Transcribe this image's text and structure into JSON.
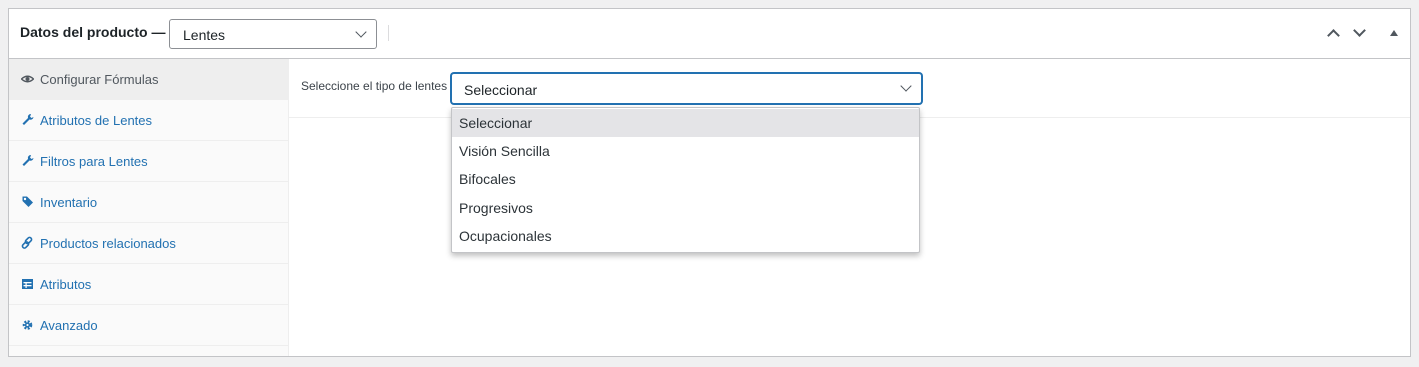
{
  "header": {
    "title": "Datos del producto —",
    "product_type": {
      "selected": "Lentes"
    }
  },
  "tabs": [
    {
      "label": "Configurar Fórmulas",
      "icon": "eye-icon",
      "active": true
    },
    {
      "label": "Atributos de Lentes",
      "icon": "wrench-icon"
    },
    {
      "label": "Filtros para Lentes",
      "icon": "wrench-icon"
    },
    {
      "label": "Inventario",
      "icon": "tag-icon"
    },
    {
      "label": "Productos relacionados",
      "icon": "link-icon"
    },
    {
      "label": "Atributos",
      "icon": "table-icon"
    },
    {
      "label": "Avanzado",
      "icon": "gear-icon"
    }
  ],
  "panel": {
    "lens_type_label": "Seleccione el tipo de lentes",
    "lens_type_value": "Seleccionar",
    "options": [
      "Seleccionar",
      "Visión Sencilla",
      "Bifocales",
      "Progresivos",
      "Ocupacionales"
    ]
  },
  "colors": {
    "link": "#2271b1",
    "border": "#c3c4c7",
    "active_tab_bg": "#eeeeee"
  }
}
